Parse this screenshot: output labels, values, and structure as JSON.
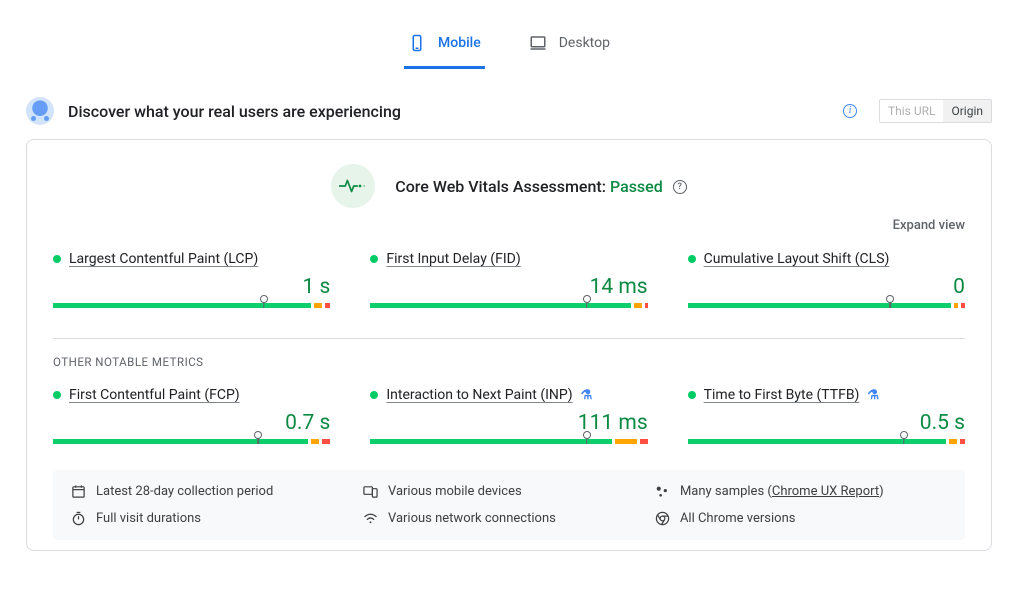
{
  "tabs": {
    "mobile": "Mobile",
    "desktop": "Desktop"
  },
  "discover": {
    "title": "Discover what your real users are experiencing",
    "toggle": {
      "url": "This URL",
      "origin": "Origin"
    }
  },
  "assessment": {
    "prefix": "Core Web Vitals Assessment:",
    "status": "Passed"
  },
  "actions": {
    "expand": "Expand view"
  },
  "section_other": "OTHER NOTABLE METRICS",
  "metrics": {
    "lcp": {
      "name": "Largest Contentful Paint (LCP)",
      "value": "1 s",
      "bar": {
        "green": 95,
        "orange": 3,
        "red": 2,
        "pointer": 76
      }
    },
    "fid": {
      "name": "First Input Delay (FID)",
      "value": "14 ms",
      "bar": {
        "green": 96,
        "orange": 3,
        "red": 1,
        "pointer": 78
      }
    },
    "cls": {
      "name": "Cumulative Layout Shift (CLS)",
      "value": "0",
      "bar": {
        "green": 97,
        "orange": 1.5,
        "red": 1.5,
        "pointer": 73
      }
    },
    "fcp": {
      "name": "First Contentful Paint (FCP)",
      "value": "0.7 s",
      "bar": {
        "green": 94,
        "orange": 3,
        "red": 3,
        "pointer": 74
      }
    },
    "inp": {
      "name": "Interaction to Next Paint (INP)",
      "value": "111 ms",
      "experimental": true,
      "bar": {
        "green": 89,
        "orange": 8,
        "red": 3,
        "pointer": 78
      }
    },
    "ttfb": {
      "name": "Time to First Byte (TTFB)",
      "value": "0.5 s",
      "experimental": true,
      "bar": {
        "green": 95,
        "orange": 3,
        "red": 2,
        "pointer": 78
      }
    }
  },
  "footer": {
    "period": "Latest 28-day collection period",
    "devices": "Various mobile devices",
    "samples": "Many samples",
    "crux": "Chrome UX Report",
    "duration": "Full visit durations",
    "network": "Various network connections",
    "chrome": "All Chrome versions"
  }
}
